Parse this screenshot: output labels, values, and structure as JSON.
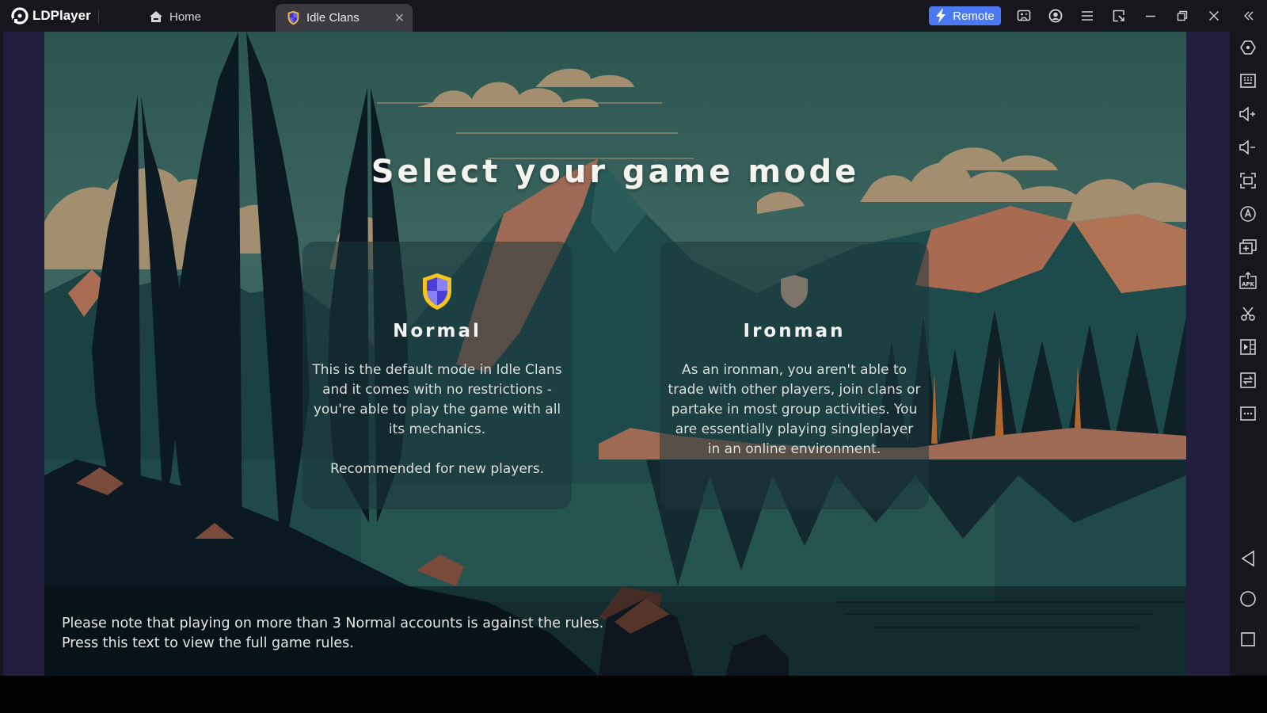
{
  "app": {
    "name": "LDPlayer",
    "tabs": [
      {
        "label": "Home",
        "icon": "home-icon",
        "active": false
      },
      {
        "label": "Idle Clans",
        "icon": "shield-icon",
        "active": true
      }
    ],
    "remote_label": "Remote",
    "toolbar_icons": [
      "gamepad-icon",
      "account-icon",
      "menu-icon",
      "window-sync-icon",
      "minimize-icon",
      "restore-icon",
      "close-icon",
      "collapse-sidebar-icon"
    ],
    "sidebar_icons": [
      "settings-hex-icon",
      "keyboard-icon",
      "volume-up-icon",
      "volume-down-icon",
      "fullscreen-icon",
      "auto-operation-icon",
      "multi-instance-icon",
      "install-apk-icon",
      "scissors-icon",
      "video-record-icon",
      "sync-icon",
      "more-icon"
    ],
    "nav_icons": [
      "back-icon",
      "home-circle-icon",
      "recents-icon"
    ],
    "colors": {
      "titlebar": "#17161c",
      "frame": "#211f3d",
      "remote_accent": "#4b79f3",
      "shield_gold": "#f5c518",
      "shield_purple": "#5a4be0"
    }
  },
  "game": {
    "title": "Select your game mode",
    "modes": [
      {
        "name": "Normal",
        "icon": "shield-normal-icon",
        "description": "This is the default mode in Idle Clans and it comes with no restrictions - you're able to play the game with all its mechanics.",
        "recommendation": "Recommended for new players."
      },
      {
        "name": "Ironman",
        "icon": "shield-ironman-icon",
        "description": "As an ironman, you aren't able to trade with other players, join clans or partake in most group activities. You are essentially playing singleplayer in an online environment."
      }
    ],
    "rules_note_line1": "Please note that playing on more than 3 Normal accounts is against the rules.",
    "rules_note_line2": "Press this text to view the full game rules."
  }
}
